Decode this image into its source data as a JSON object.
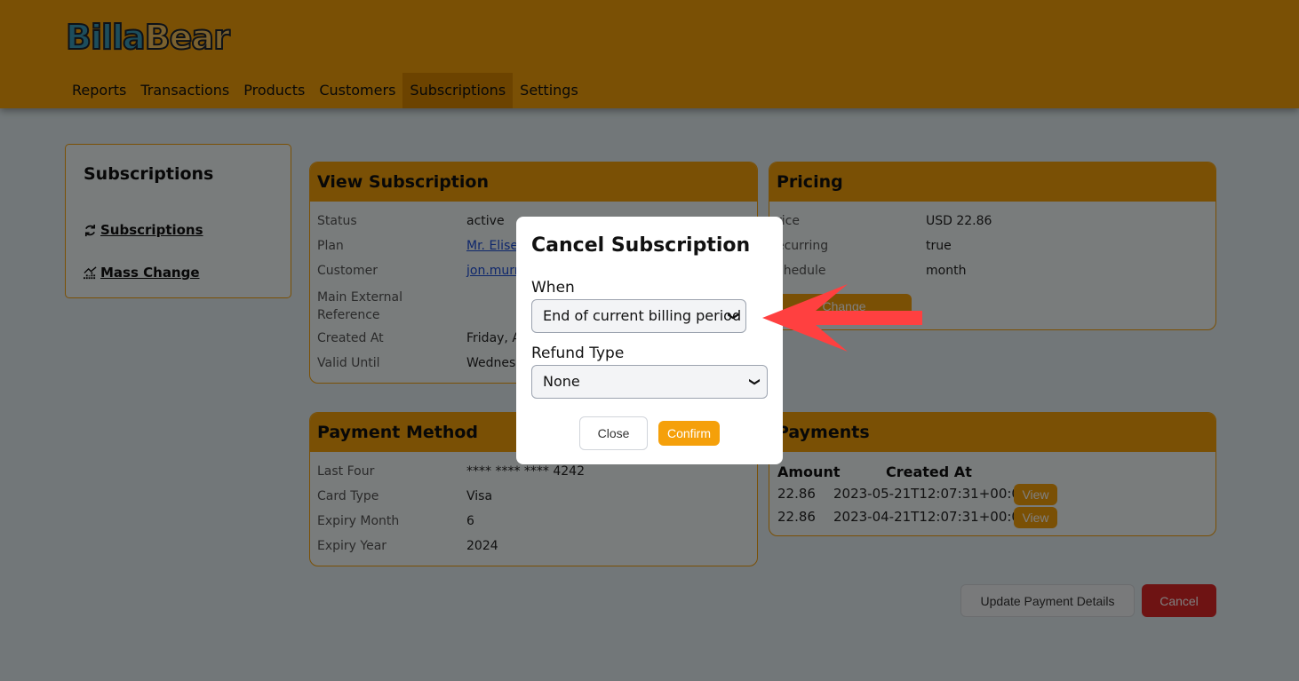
{
  "brand": {
    "part1": "Billa",
    "part2": "Bear"
  },
  "nav": {
    "items": [
      {
        "label": "Reports"
      },
      {
        "label": "Transactions"
      },
      {
        "label": "Products"
      },
      {
        "label": "Customers"
      },
      {
        "label": "Subscriptions",
        "active": true
      },
      {
        "label": "Settings"
      }
    ]
  },
  "sidebar": {
    "title": "Subscriptions",
    "links": [
      {
        "label": "Subscriptions",
        "icon": "refresh-icon"
      },
      {
        "label": "Mass Change",
        "icon": "chart-icon"
      }
    ]
  },
  "view_subscription": {
    "title": "View Subscription",
    "rows": [
      {
        "label": "Status",
        "value": "active"
      },
      {
        "label": "Plan",
        "value": "Mr. Elised"
      },
      {
        "label": "Customer",
        "value": "jon.murra"
      },
      {
        "label": "Main External Reference",
        "value": ""
      },
      {
        "label": "Created At",
        "value": "Friday, Ap"
      },
      {
        "label": "Valid Until",
        "value": "Wednesd"
      }
    ]
  },
  "pricing": {
    "title": "Pricing",
    "rows": [
      {
        "label": "rice",
        "value": "USD 22.86"
      },
      {
        "label": "ecurring",
        "value": "true"
      },
      {
        "label": "chedule",
        "value": "month"
      }
    ],
    "change_label": "Change"
  },
  "payment_method": {
    "title": "Payment Method",
    "rows": [
      {
        "label": "Last Four",
        "value": "**** **** **** 4242"
      },
      {
        "label": "Card Type",
        "value": "Visa"
      },
      {
        "label": "Expiry Month",
        "value": "6"
      },
      {
        "label": "Expiry Year",
        "value": "2024"
      }
    ]
  },
  "payments": {
    "title": "Payments",
    "headers": [
      "Amount",
      "Created At"
    ],
    "rows": [
      {
        "amount": "22.86",
        "created_at": "2023-05-21T12:07:31+00:00",
        "action": "View"
      },
      {
        "amount": "22.86",
        "created_at": "2023-04-21T12:07:31+00:00",
        "action": "View"
      }
    ]
  },
  "actions": {
    "update_payment_label": "Update Payment Details",
    "cancel_label": "Cancel"
  },
  "modal": {
    "title": "Cancel Subscription",
    "when_label": "When",
    "when_value": "End of current billing period",
    "refund_label": "Refund Type",
    "refund_value": "None",
    "close_label": "Close",
    "confirm_label": "Confirm"
  },
  "colors": {
    "accent": "#f5a00a",
    "nav_active": "#d98600",
    "danger": "#dc2626",
    "arrow": "#ff4040"
  }
}
